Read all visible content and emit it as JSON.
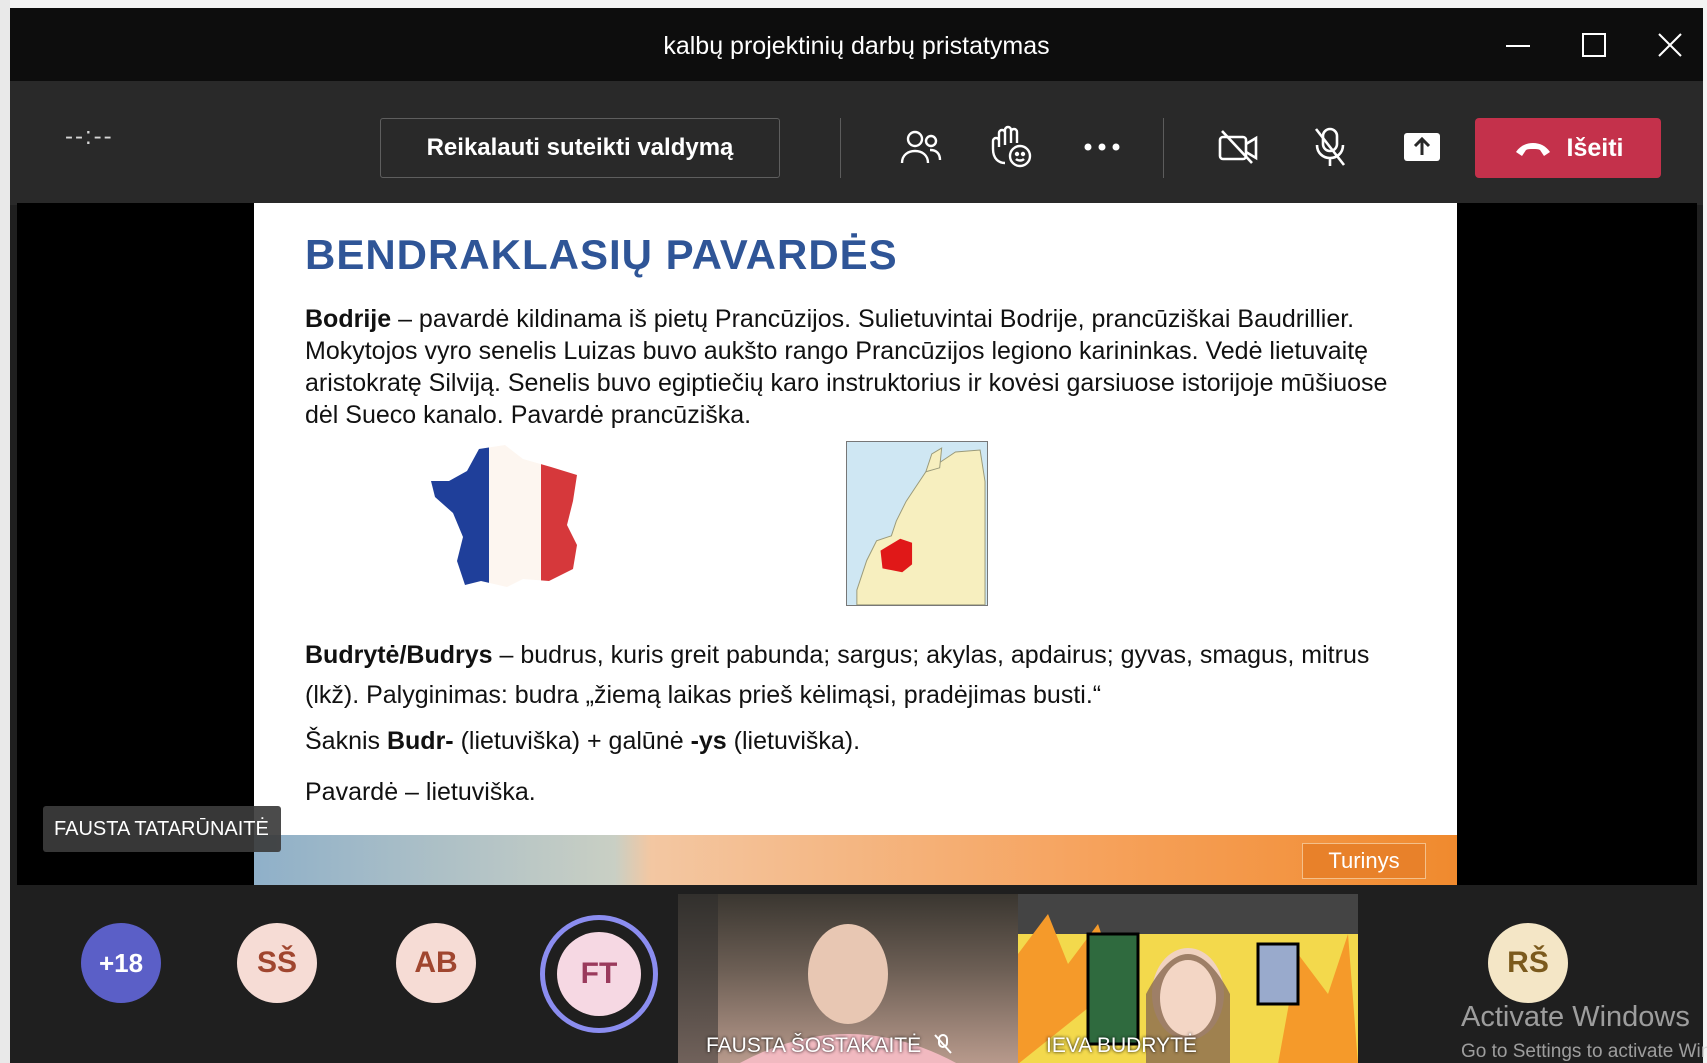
{
  "window": {
    "title": "kalbų projektinių darbų pristatymas"
  },
  "toolbar": {
    "timer": "--:--",
    "request_control_label": "Reikalauti suteikti valdymą",
    "leave_label": "Išeiti"
  },
  "slide": {
    "title": "BENDRAKLASIŲ PAVARDĖS",
    "p1_bold": "Bodrije",
    "p1_text": " – pavardė kildinama iš pietų Prancūzijos. Sulietuvintai Bodrije, prancūziškai Baudrillier. Mokytojos vyro senelis Luizas buvo aukšto rango Prancūzijos legiono karininkas. Vedė lietuvaitę aristokratę Silviją. Senelis buvo egiptiečių karo instruktorius ir kovėsi garsiuose istorijoje mūšiuose dėl Sueco kanalo. Pavardė prancūziška.",
    "p2_bold": "Budrytė/Budrys",
    "p2_text": " – budrus, kuris greit pabunda; sargus; akylas, apdairus; gyvas, smagus, mitrus (lkž). Palyginimas: budra „žiemą laikas prieš kėlimąsi, pradėjimas busti.“",
    "p3_a": "Šaknis ",
    "p3_b": "Budr-",
    "p3_c": " (lietuviška) + galūnė ",
    "p3_d": "-ys",
    "p3_e": " (lietuviška).",
    "p4": "Pavardė – lietuviška.",
    "turinys_label": "Turinys"
  },
  "presenter_name": "FAUSTA TATARŪNAITĖ",
  "participants": {
    "more_count": "+18",
    "avatars": [
      {
        "initials": "SŠ",
        "bg": "#f6dcd5",
        "fg": "#a0462f"
      },
      {
        "initials": "AB",
        "bg": "#f6dcd5",
        "fg": "#a0462f"
      },
      {
        "initials": "FT",
        "bg": "#f6d8e3",
        "fg": "#9a3a5c"
      },
      {
        "initials": "RŠ",
        "bg": "#f4e6c6",
        "fg": "#7b5a1d"
      }
    ],
    "tile1_name": "FAUSTA ŠOSTAKAITĖ",
    "tile2_name": "IEVA BUDRYTĖ"
  },
  "watermark": {
    "line1": "Activate Windows",
    "line2": "Go to Settings to activate Windows."
  },
  "colors": {
    "accent": "#6264a7",
    "leave": "#c4314b",
    "slide_title": "#2f5597"
  }
}
